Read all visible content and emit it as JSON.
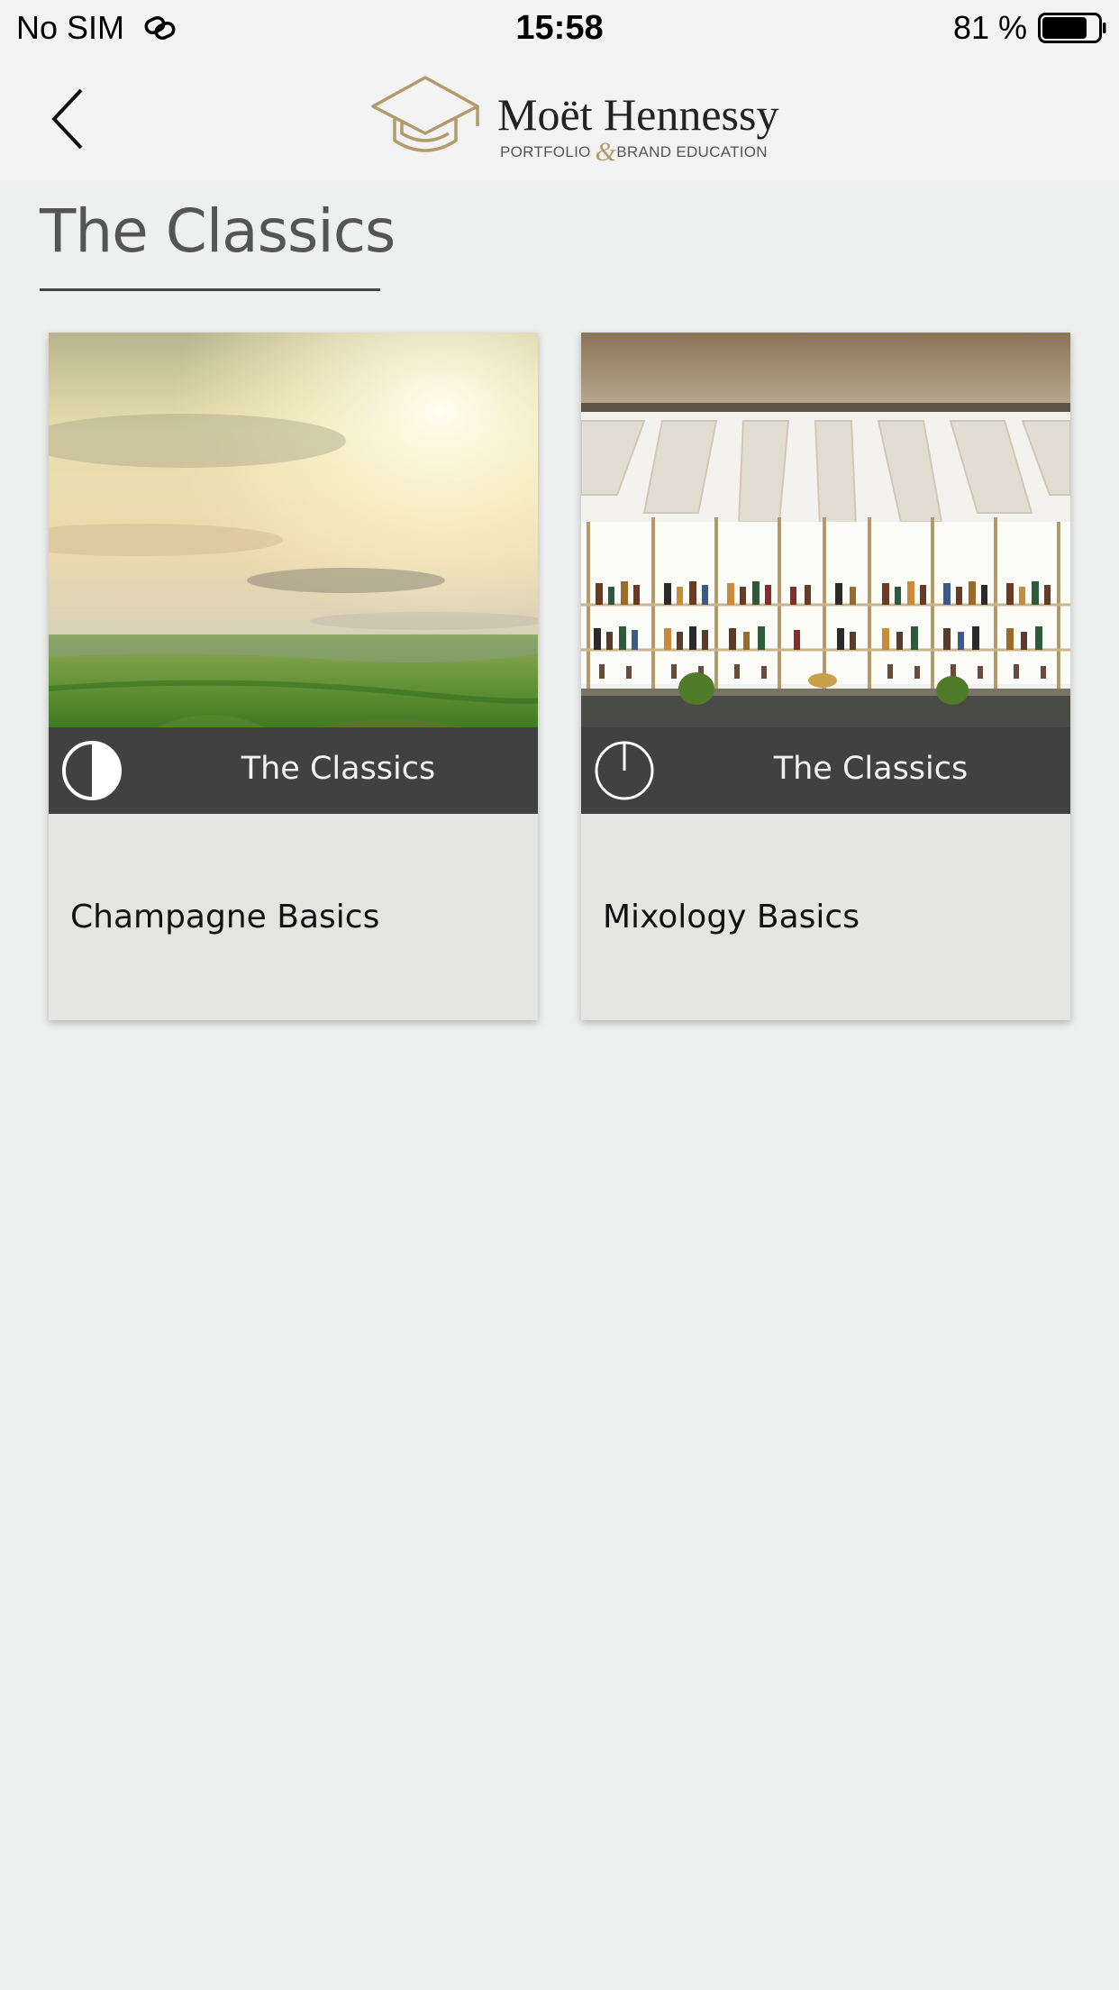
{
  "status_bar": {
    "carrier": "No SIM",
    "time": "15:58",
    "battery": "81 %",
    "battery_level": 0.81
  },
  "nav": {
    "back_icon": "chevron-left-icon",
    "logo_icon": "graduation-cap-icon",
    "logo_main": "Moët Hennessy",
    "logo_sub_left": "PORTFOLIO",
    "logo_sub_amp": "&",
    "logo_sub_right": "BRAND EDUCATION",
    "logo_color": "#b39a6b"
  },
  "page": {
    "title": "The Classics"
  },
  "cards": [
    {
      "category": "The Classics",
      "title": "Champagne Basics",
      "progress": 0.5,
      "image": "vineyard-landscape"
    },
    {
      "category": "The Classics",
      "title": "Mixology Basics",
      "progress": 0.0,
      "image": "bar-interior"
    }
  ]
}
